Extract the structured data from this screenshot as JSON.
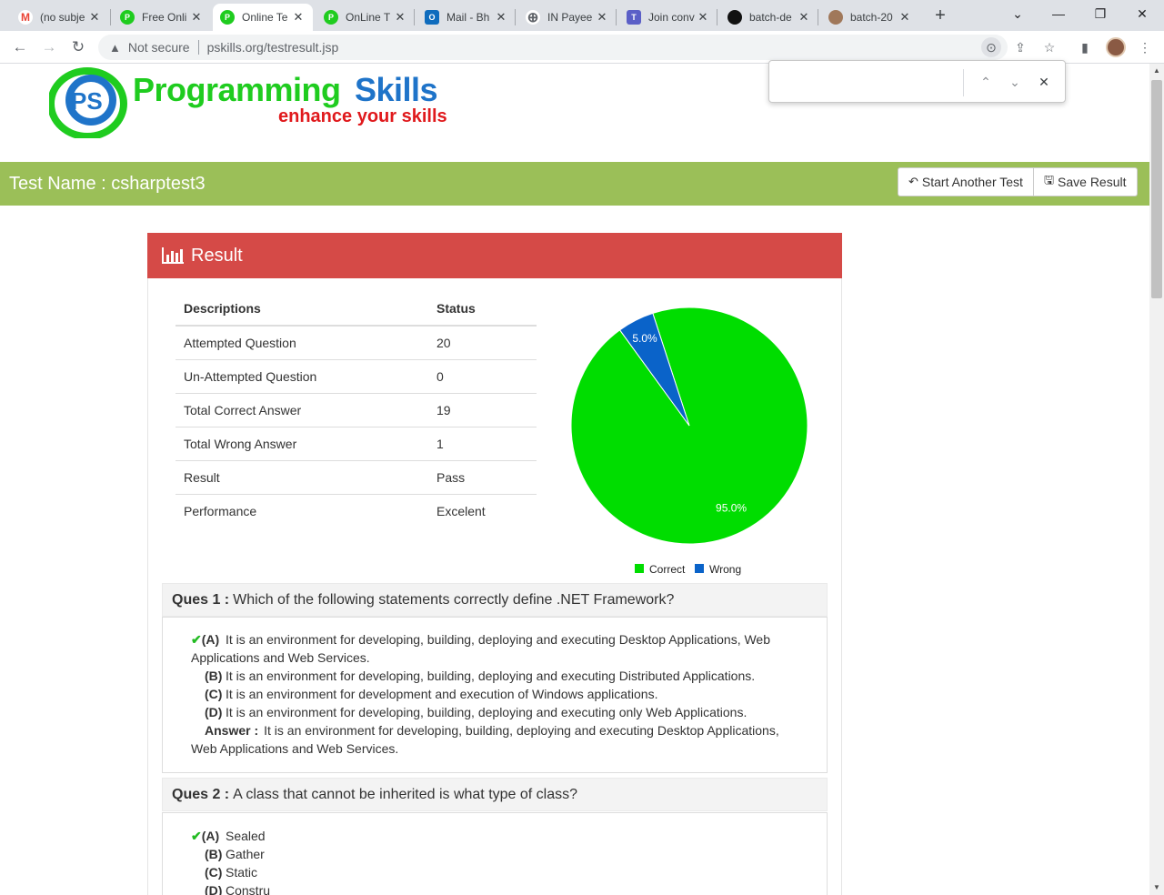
{
  "browser": {
    "tabs": [
      {
        "label": "(no subje",
        "icon": "gmail-icon",
        "color": "#ea4335",
        "glyph": "M"
      },
      {
        "label": "Free Onli",
        "icon": "ps-favicon-icon",
        "color": "#1fcc1f",
        "glyph": "P"
      },
      {
        "label": "Online Te",
        "icon": "ps-favicon-icon",
        "color": "#1fcc1f",
        "glyph": "P",
        "active": true
      },
      {
        "label": "OnLine T",
        "icon": "ps-favicon-icon",
        "color": "#1fcc1f",
        "glyph": "P"
      },
      {
        "label": "Mail - Bh",
        "icon": "outlook-icon",
        "color": "#0f6cbd",
        "glyph": "O"
      },
      {
        "label": "IN Payee",
        "icon": "globe-icon",
        "color": "#5f6368",
        "glyph": "⊕"
      },
      {
        "label": "Join conv",
        "icon": "teams-icon",
        "color": "#5b5fc7",
        "glyph": "T"
      },
      {
        "label": "batch-de",
        "icon": "github-icon",
        "color": "#111111",
        "glyph": "●"
      },
      {
        "label": "batch-20",
        "icon": "avatar-icon",
        "color": "#a0785a",
        "glyph": "●"
      }
    ],
    "security_label": "Not secure",
    "url": "pskills.org/testresult.jsp"
  },
  "find_bar": {
    "value": ""
  },
  "brand": {
    "name_part1": "Programming",
    "name_part2": "Skills",
    "tagline": "enhance your skills",
    "logo_text": "PS",
    "color_green": "#1fcc1f",
    "color_blue": "#1f74c9",
    "color_red": "#e0191c"
  },
  "test": {
    "name": "Test Name : csharptest3",
    "start_another_label": "Start Another Test",
    "save_result_label": "Save Result",
    "bar_color": "#9bbf58"
  },
  "result_panel": {
    "title": "Result",
    "header_color": "#d54a47",
    "table_headers": [
      "Descriptions",
      "Status"
    ],
    "rows": [
      [
        "Attempted Question",
        "20"
      ],
      [
        "Un-Attempted Question",
        "0"
      ],
      [
        "Total Correct Answer",
        "19"
      ],
      [
        "Total Wrong Answer",
        "1"
      ],
      [
        "Result",
        "Pass"
      ],
      [
        "Performance",
        "Excelent"
      ]
    ]
  },
  "chart_data": {
    "type": "pie",
    "categories": [
      "Correct",
      "Wrong"
    ],
    "values": [
      95.0,
      5.0
    ],
    "labels": [
      "95.0%",
      "5.0%"
    ],
    "colors": [
      "#00dd00",
      "#0a63c9"
    ],
    "legend_position": "bottom"
  },
  "questions": [
    {
      "number_label": "Ques 1 :",
      "text": "Which of the following statements correctly define .NET Framework?",
      "options": [
        {
          "letter": "(A)",
          "text": "It is an environment for developing, building, deploying and executing Desktop Applications, Web Applications and Web Services.",
          "correct": true
        },
        {
          "letter": "(B)",
          "text": "It is an environment for developing, building, deploying and executing Distributed Applications.",
          "correct": false
        },
        {
          "letter": "(C)",
          "text": "It is an environment for development and execution of Windows applications.",
          "correct": false
        },
        {
          "letter": "(D)",
          "text": "It is an environment for developing, building, deploying and executing only Web Applications.",
          "correct": false
        }
      ],
      "answer_label": "Answer :",
      "answer_text": "It is an environment for developing, building, deploying and executing Desktop Applications, Web Applications and Web Services."
    },
    {
      "number_label": "Ques 2 :",
      "text": "A class that cannot be inherited is what type of class?",
      "options": [
        {
          "letter": "(A)",
          "text": "Sealed",
          "correct": true
        },
        {
          "letter": "(B)",
          "text": "Gather",
          "correct": false
        },
        {
          "letter": "(C)",
          "text": "Static",
          "correct": false
        },
        {
          "letter": "(D)",
          "text": "Constru",
          "correct": false
        }
      ]
    }
  ]
}
